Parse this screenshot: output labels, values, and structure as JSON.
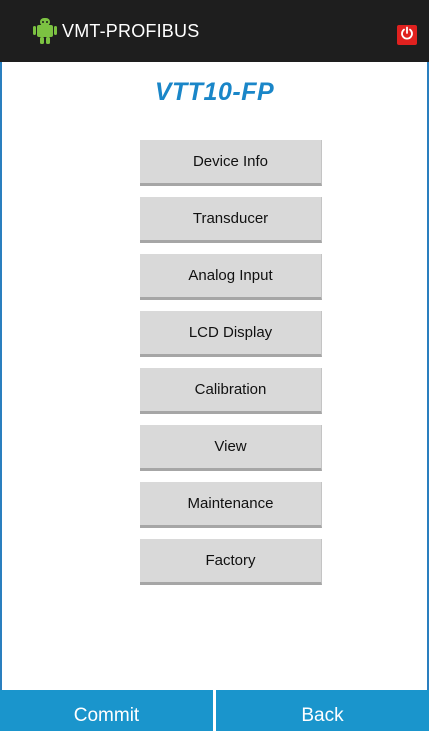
{
  "header": {
    "app_title": "VMT-PROFIBUS",
    "app_icon": "android-robot-icon",
    "power_icon": "power-icon",
    "background_color": "#1e1e1e",
    "power_color": "#e0211f"
  },
  "device_title": "VTT10-FP",
  "menu": {
    "items": [
      {
        "label": "Device Info"
      },
      {
        "label": "Transducer"
      },
      {
        "label": "Analog Input"
      },
      {
        "label": "LCD Display"
      },
      {
        "label": "Calibration"
      },
      {
        "label": "View"
      },
      {
        "label": "Maintenance"
      },
      {
        "label": "Factory"
      }
    ]
  },
  "footer": {
    "commit_label": "Commit",
    "back_label": "Back",
    "accent_color": "#1a95cc"
  }
}
